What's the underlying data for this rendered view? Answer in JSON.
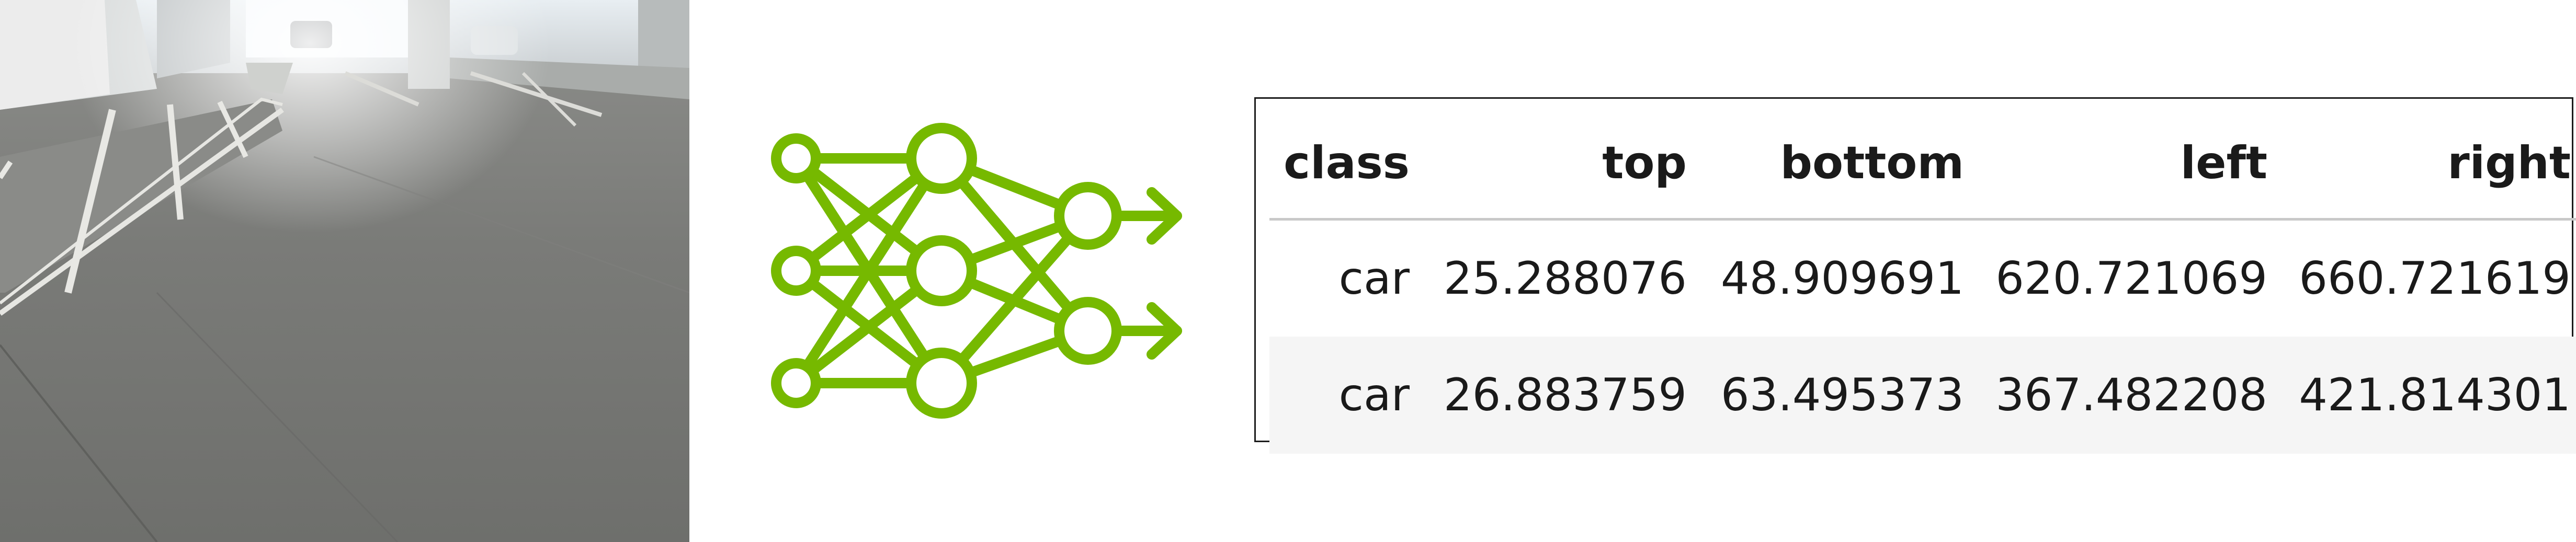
{
  "colors": {
    "network_green": "#76b900",
    "table_border": "#1c1c1c",
    "header_rule": "#c9c9c9",
    "row_stripe": "#f5f5f5"
  },
  "photo": {
    "scene": "parking garage camera view"
  },
  "network": {
    "icon": "neural-network-icon",
    "layers": [
      3,
      3,
      2
    ],
    "outputs": 2
  },
  "table": {
    "headers": [
      "class",
      "top",
      "bottom",
      "left",
      "right"
    ],
    "rows": [
      [
        "car",
        "25.288076",
        "48.909691",
        "620.721069",
        "660.721619"
      ],
      [
        "car",
        "26.883759",
        "63.495373",
        "367.482208",
        "421.814301"
      ]
    ]
  }
}
